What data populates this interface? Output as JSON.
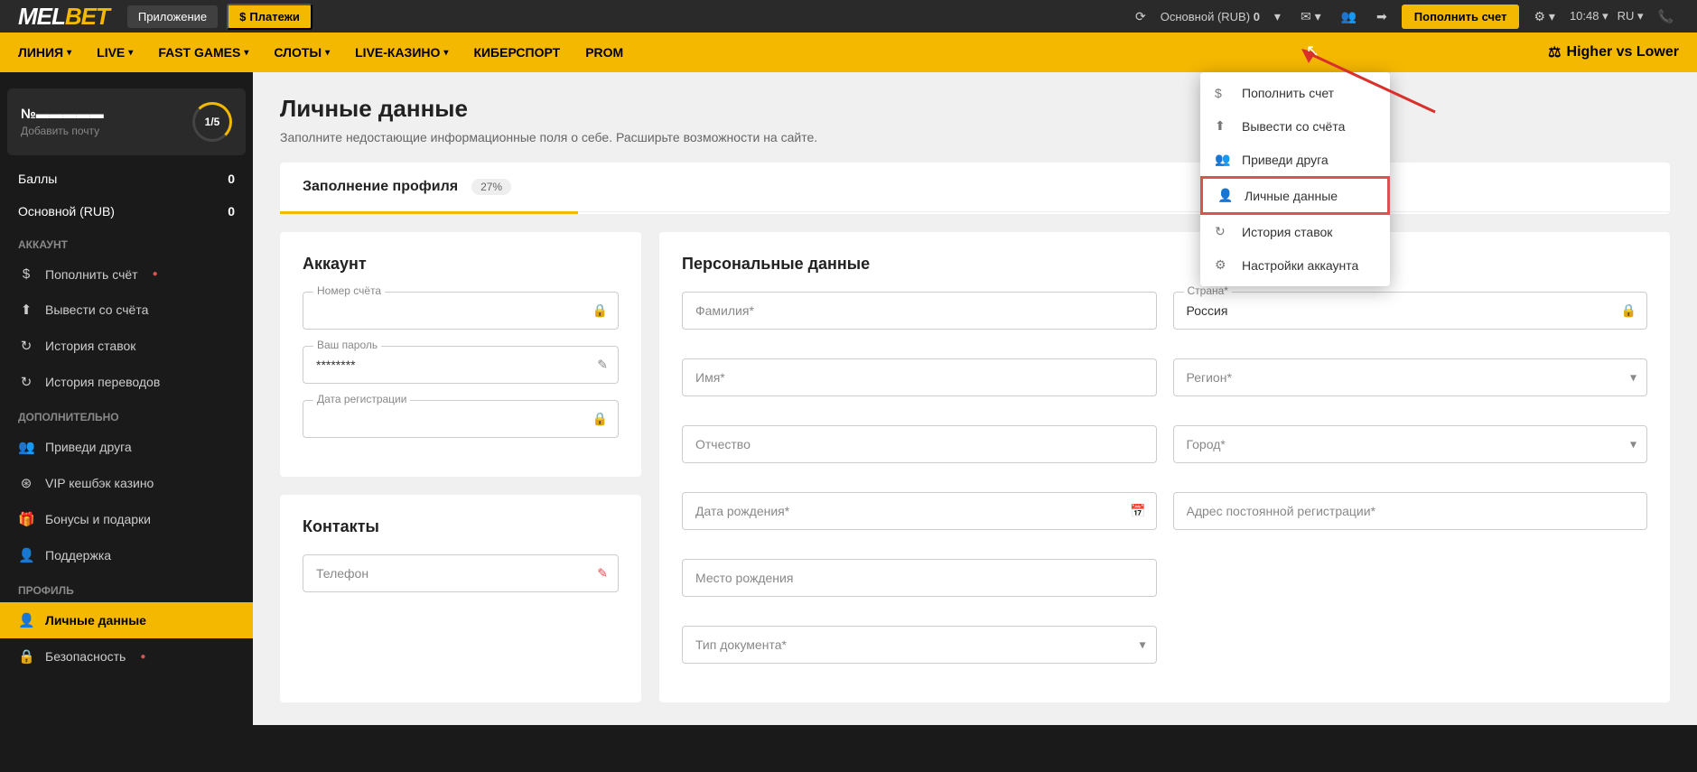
{
  "topbar": {
    "app_label": "Приложение",
    "payments_label": "Платежи",
    "balance_label": "Основной (RUB)",
    "balance_value": "0",
    "deposit_label": "Пополнить счет",
    "time": "10:48",
    "lang": "RU"
  },
  "nav": {
    "items": [
      {
        "label": "ЛИНИЯ",
        "chevron": true
      },
      {
        "label": "LIVE",
        "chevron": true
      },
      {
        "label": "FAST GAMES",
        "chevron": true
      },
      {
        "label": "СЛОТЫ",
        "chevron": true
      },
      {
        "label": "LIVE-КАЗИНО",
        "chevron": true
      },
      {
        "label": "КИБЕРСПОРТ",
        "chevron": false
      },
      {
        "label": "PROM",
        "chevron": false
      }
    ],
    "right_label": "Higher vs Lower"
  },
  "dropdown": {
    "items": [
      {
        "icon": "dollar",
        "label": "Пополнить счет"
      },
      {
        "icon": "upload",
        "label": "Вывести со счёта"
      },
      {
        "icon": "users",
        "label": "Приведи друга"
      },
      {
        "icon": "user",
        "label": "Личные данные"
      },
      {
        "icon": "history",
        "label": "История ставок"
      },
      {
        "icon": "gear",
        "label": "Настройки аккаунта"
      }
    ]
  },
  "sidebar": {
    "user_id": "№▬▬▬▬▬",
    "user_email_hint": "Добавить почту",
    "progress": "1/5",
    "balance_rows": [
      {
        "label": "Баллы",
        "value": "0"
      },
      {
        "label": "Основной (RUB)",
        "value": "0"
      }
    ],
    "sections": {
      "account": "АККАУНТ",
      "extra": "ДОПОЛНИТЕЛЬНО",
      "profile": "ПРОФИЛЬ"
    },
    "account_items": [
      {
        "icon": "dollar",
        "label": "Пополнить счёт",
        "warn": true
      },
      {
        "icon": "upload",
        "label": "Вывести со счёта"
      },
      {
        "icon": "history",
        "label": "История ставок"
      },
      {
        "icon": "history",
        "label": "История переводов"
      }
    ],
    "extra_items": [
      {
        "icon": "users",
        "label": "Приведи друга"
      },
      {
        "icon": "cashback",
        "label": "VIP кешбэк казино"
      },
      {
        "icon": "gift",
        "label": "Бонусы и подарки"
      },
      {
        "icon": "support",
        "label": "Поддержка"
      }
    ],
    "profile_items": [
      {
        "icon": "user",
        "label": "Личные данные",
        "active": true
      },
      {
        "icon": "lock",
        "label": "Безопасность",
        "warn": true
      }
    ]
  },
  "page": {
    "title": "Личные данные",
    "subtitle": "Заполните недостающие информационные поля о себе. Расширьте возможности на сайте.",
    "tab_label": "Заполнение профиля",
    "tab_percent": "27%",
    "account_card_title": "Аккаунт",
    "contacts_card_title": "Контакты",
    "personal_card_title": "Персональные данные",
    "account_fields": {
      "number_label": "Номер счёта",
      "password_label": "Ваш пароль",
      "password_value": "********",
      "regdate_label": "Дата регистрации"
    },
    "contacts": {
      "phone_placeholder": "Телефон"
    },
    "personal": {
      "surname": "Фамилия*",
      "name": "Имя*",
      "patronymic": "Отчество",
      "birthdate": "Дата рождения*",
      "birthplace": "Место рождения",
      "doctype": "Тип документа*",
      "country_label": "Страна*",
      "country_value": "Россия",
      "region": "Регион*",
      "city": "Город*",
      "address": "Адрес постоянной регистрации*"
    }
  }
}
